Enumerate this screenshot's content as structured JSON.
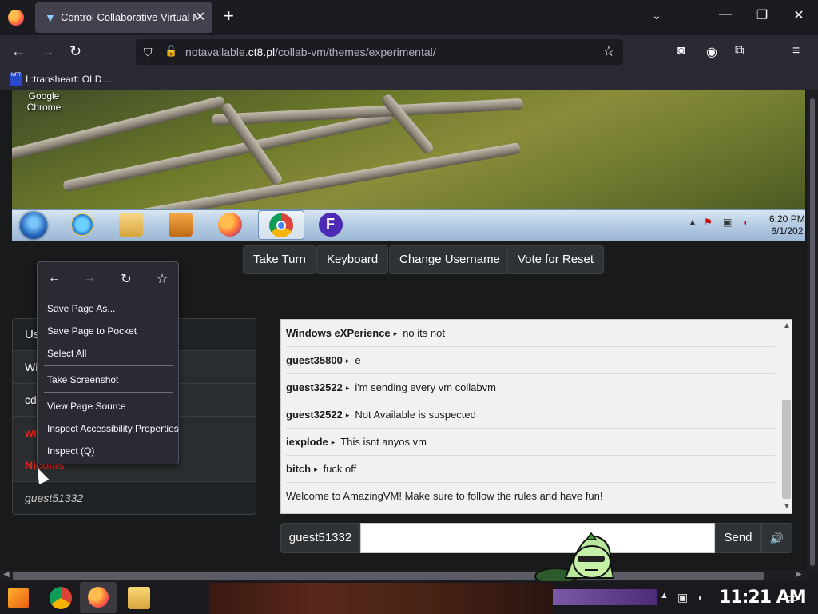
{
  "browser": {
    "tab_title": "Control Collaborative Virtual M",
    "tab_close": "✕",
    "new_tab": "+",
    "tab_list": "⌄",
    "url_prefix": "notavailable.",
    "url_host": "ct8.pl",
    "url_path": "/collab-vm/themes/experimental/",
    "bookmark_label": "I :transheart: OLD ...",
    "bookmark_icon_text": "MFT",
    "icons": [
      "back-arrow-icon",
      "forward-arrow-icon",
      "reload-icon",
      "shield-icon",
      "lock-icon",
      "star-icon",
      "pocket-icon",
      "account-icon",
      "extensions-icon",
      "menu-icon"
    ]
  },
  "window_controls": {
    "minimize": "—",
    "maximize": "❐",
    "close": "✕"
  },
  "vm_screen": {
    "desktop_icon_label": "Google Chrome",
    "clock_time": "6:20 PM",
    "clock_date": "6/1/202",
    "taskbar_apps": [
      "start-orb",
      "internet-explorer",
      "libraries",
      "media-player",
      "firefox",
      "chrome",
      "app-f"
    ]
  },
  "vm_controls": {
    "take_turn": "Take Turn",
    "keyboard": "Keyboard",
    "change_username": "Change Username",
    "vote_for_reset": "Vote for Reset"
  },
  "users_panel": {
    "header": "Us",
    "rows": [
      {
        "name": "Wi",
        "style": "normal"
      },
      {
        "name": "cd",
        "style": "normal"
      },
      {
        "name": "wi",
        "style": "red"
      },
      {
        "name": "Nicolas",
        "style": "red"
      },
      {
        "name": "guest51332",
        "style": "guest"
      }
    ]
  },
  "chat": {
    "messages": [
      {
        "user": "Windows eXPerience",
        "text": "no its not"
      },
      {
        "user": "guest35800",
        "text": "e"
      },
      {
        "user": "guest32522",
        "text": "i'm sending every vm collabvm"
      },
      {
        "user": "guest32522",
        "text": "Not Available is suspected"
      },
      {
        "user": "iexplode",
        "text": "This isnt anyos vm"
      },
      {
        "user": "bitch",
        "text": "fuck off"
      }
    ],
    "welcome": "Welcome to AmazingVM! Make sure to follow the rules and have fun!",
    "arrow": "▸",
    "username": "guest51332",
    "input_value": "",
    "send_label": "Send",
    "volume_icon": "🔊"
  },
  "context_menu": {
    "items": [
      "Save Page As...",
      "Save Page to Pocket",
      "Select All",
      "Take Screenshot",
      "View Page Source",
      "Inspect Accessibility Properties",
      "Inspect (Q)"
    ]
  },
  "host_taskbar": {
    "clock": "11:21 AM",
    "apps": [
      "start",
      "chrome",
      "firefox",
      "file-explorer"
    ]
  }
}
